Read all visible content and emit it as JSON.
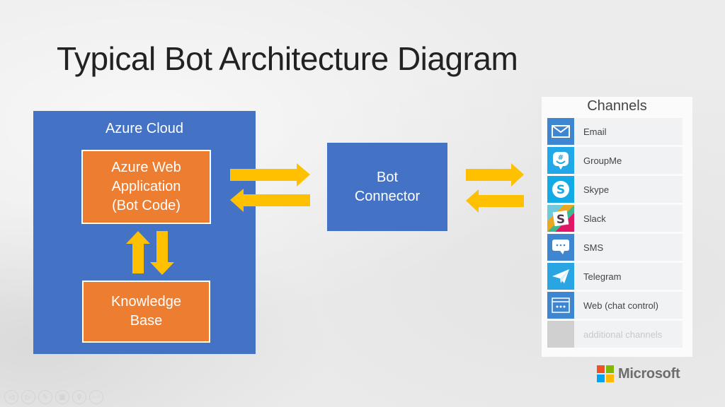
{
  "title": "Typical Bot Architecture Diagram",
  "azure_cloud": {
    "label": "Azure Cloud",
    "web_app": {
      "line1": "Azure Web",
      "line2": "Application",
      "line3": "(Bot Code)"
    },
    "knowledge_base": {
      "line1": "Knowledge",
      "line2": "Base"
    }
  },
  "bot_connector": {
    "line1": "Bot",
    "line2": "Connector"
  },
  "channels": {
    "title": "Channels",
    "items": [
      {
        "label": "Email",
        "icon": "email-icon",
        "color": "#3e86d0"
      },
      {
        "label": "GroupMe",
        "icon": "groupme-icon",
        "color": "#20a8e8"
      },
      {
        "label": "Skype",
        "icon": "skype-icon",
        "color": "#14aae6"
      },
      {
        "label": "Slack",
        "icon": "slack-icon",
        "color": "#ffffff"
      },
      {
        "label": "SMS",
        "icon": "sms-icon",
        "color": "#3e86d0"
      },
      {
        "label": "Telegram",
        "icon": "telegram-icon",
        "color": "#2aa5e3"
      },
      {
        "label": "Web (chat control)",
        "icon": "web-chat-icon",
        "color": "#3e86d0"
      },
      {
        "label": "additional channels",
        "icon": "placeholder-icon",
        "color": "#d0d0d0"
      }
    ]
  },
  "colors": {
    "azure_blue": "#4472c4",
    "orange": "#ed7d31",
    "arrow_yellow": "#ffc000"
  },
  "logo": {
    "text": "Microsoft"
  }
}
